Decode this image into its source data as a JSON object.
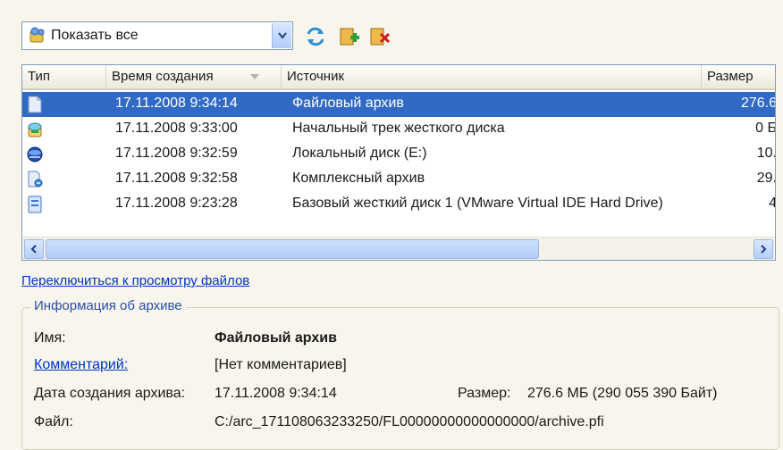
{
  "toolbar": {
    "filter_value": "Показать все",
    "icons": [
      "filter-icon",
      "refresh-icon",
      "add-icon",
      "remove-icon"
    ]
  },
  "list": {
    "columns": [
      {
        "label": "Тип"
      },
      {
        "label": "Время создания"
      },
      {
        "label": "Источник"
      },
      {
        "label": "Размер"
      }
    ],
    "rows": [
      {
        "icon": "file-archive-icon",
        "time": "17.11.2008 9:34:14",
        "source": "Файловый архив",
        "size": "276.6",
        "selected": true
      },
      {
        "icon": "track-icon",
        "time": "17.11.2008 9:33:00",
        "source": "Начальный трек жесткого диска",
        "size": "0 Б",
        "selected": false
      },
      {
        "icon": "disk-icon",
        "time": "17.11.2008 9:32:59",
        "source": "Локальный диск (E:)",
        "size": "10.",
        "selected": false
      },
      {
        "icon": "complex-archive-icon",
        "time": "17.11.2008 9:32:58",
        "source": "Комплексный архив",
        "size": "29.",
        "selected": false
      },
      {
        "icon": "hard-disk-icon",
        "time": "17.11.2008 9:23:28",
        "source": "Базовый жесткий диск 1 (VMware Virtual IDE Hard Drive)",
        "size": "4",
        "selected": false
      }
    ]
  },
  "switch_link": "Переключиться к просмотру файлов",
  "archive_info": {
    "title": "Информация об архиве",
    "name_label": "Имя:",
    "name_value": "Файловый архив",
    "comment_label": "Комментарий:",
    "comment_value": "[Нет комментариев]",
    "date_label": "Дата создания архива:",
    "date_value": "17.11.2008 9:34:14",
    "size_label": "Размер:",
    "size_value": "276.6 МБ (290 055 390 Байт)",
    "file_label": "Файл:",
    "file_value": "C:/arc_171108063233250/FL00000000000000000/archive.pfi"
  },
  "colors": {
    "selection": "#316ac5",
    "link": "#0033cc",
    "background": "#f7f5ec"
  }
}
